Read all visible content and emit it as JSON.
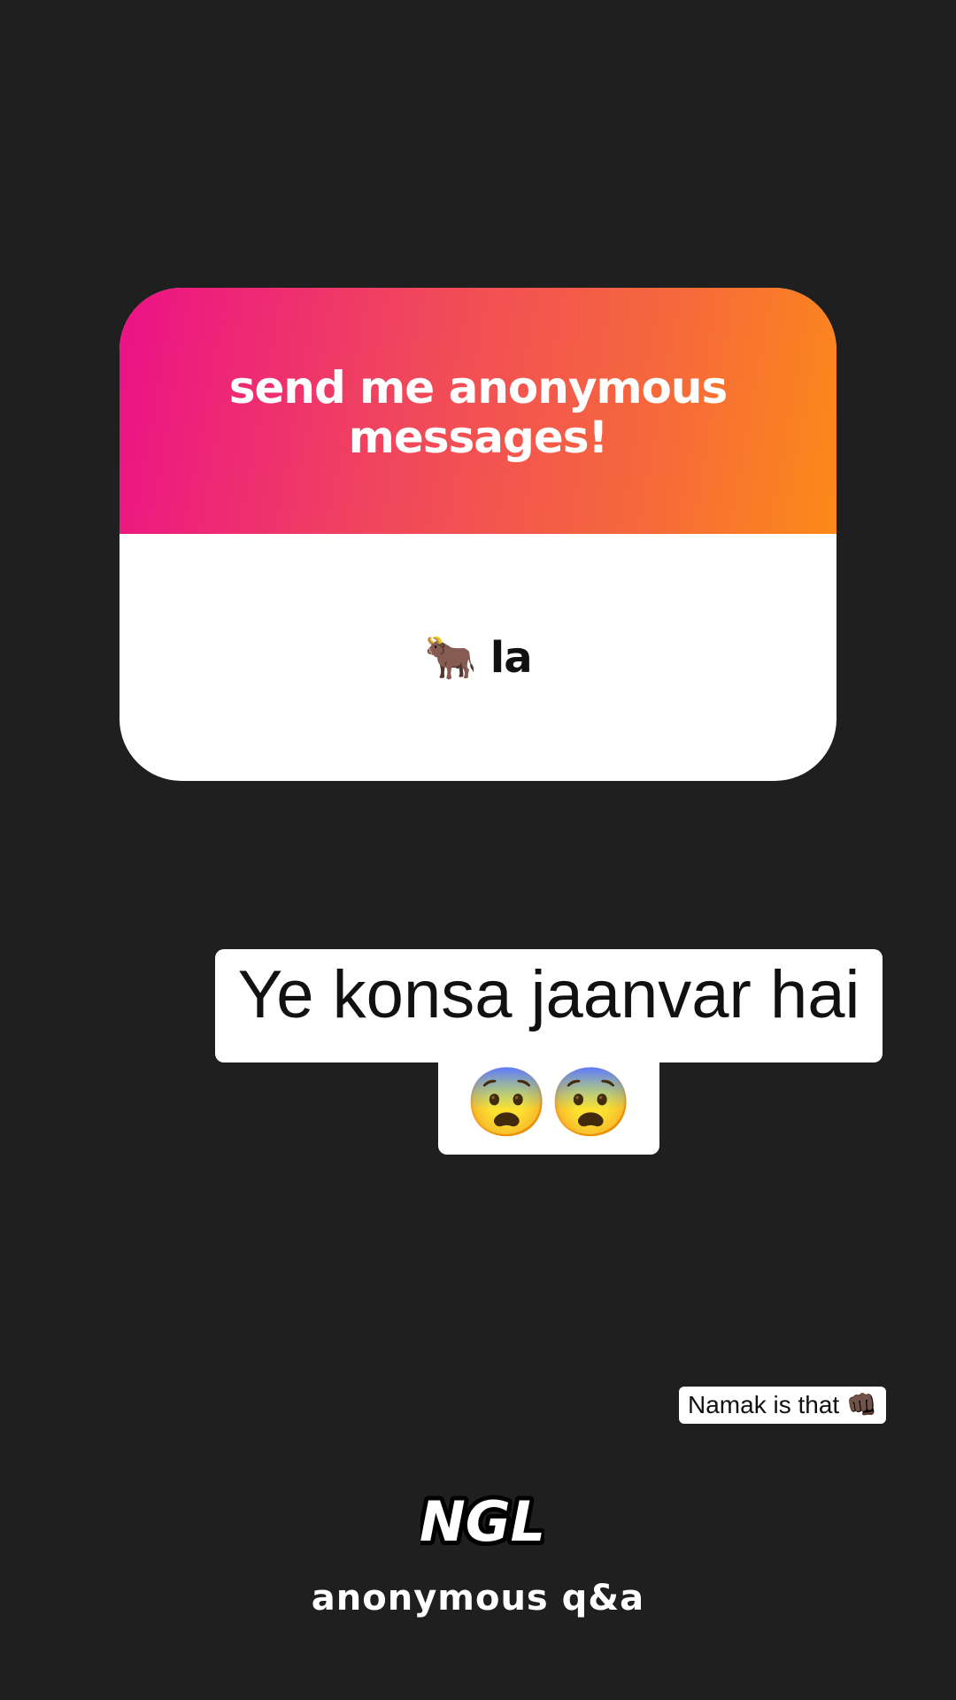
{
  "card": {
    "title": "send me anonymous messages!",
    "answer": "🐂 la",
    "gradient_colors": [
      "#ec1187",
      "#f0475c",
      "#f66a3a",
      "#fd8a18"
    ]
  },
  "overlay": {
    "line1": "Ye konsa jaanvar hai",
    "line2": "😨😨"
  },
  "sticker_note": "Namak is that 👊🏿",
  "branding": {
    "logo_text": "NGL",
    "caption": "anonymous q&a"
  },
  "colors": {
    "background": "#1f1f1f"
  }
}
